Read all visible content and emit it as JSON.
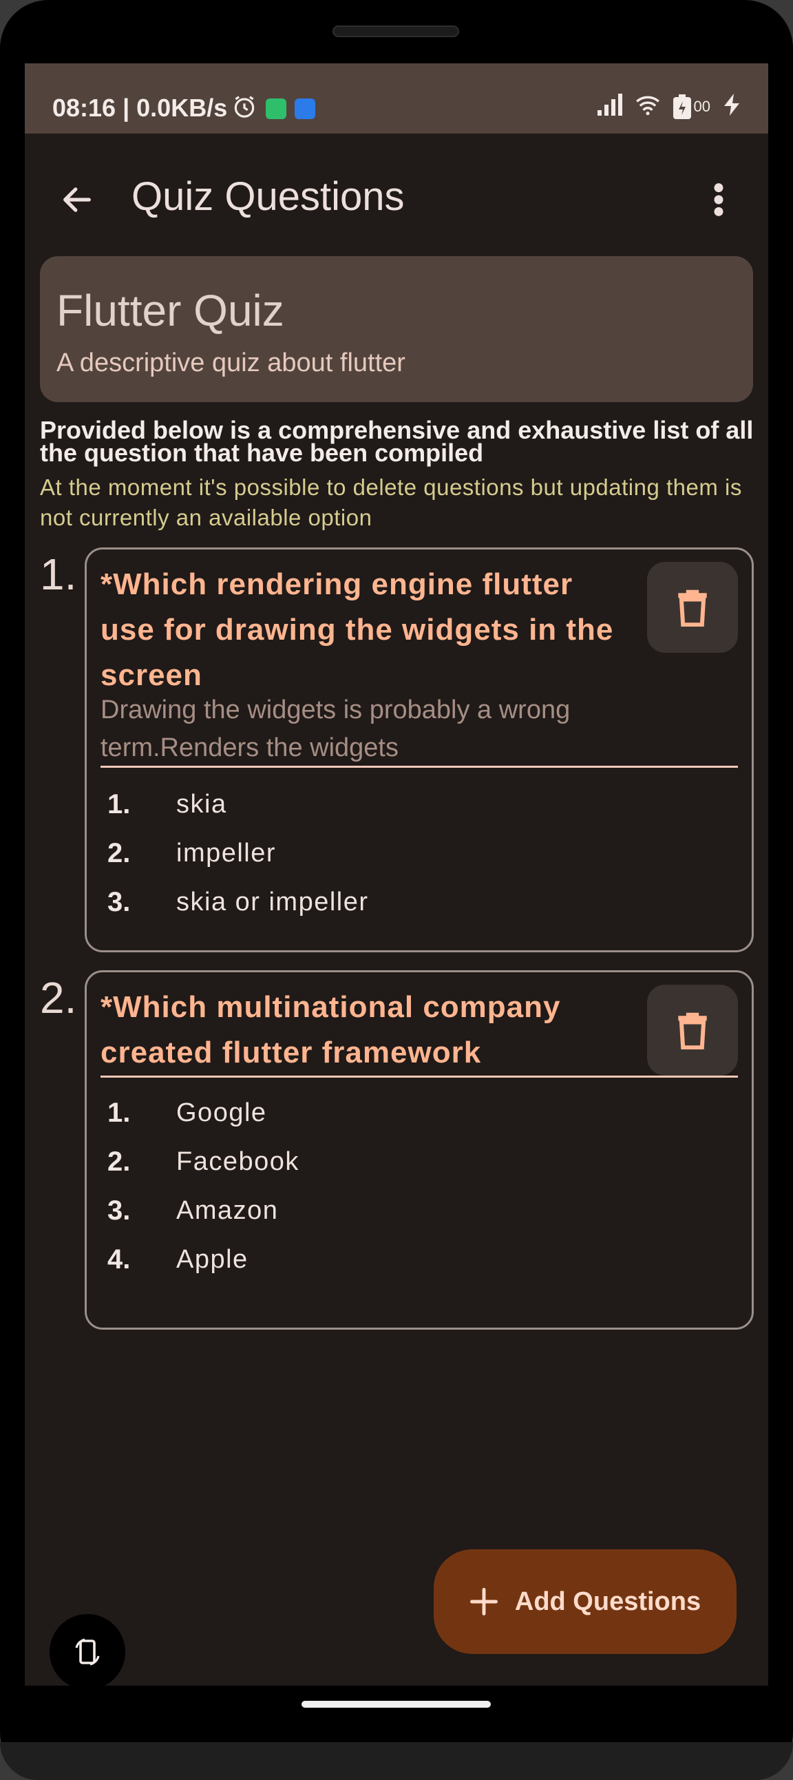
{
  "status_bar": {
    "time": "08:16 | 0.0KB/s",
    "battery": "00",
    "icons": [
      "alarm-icon",
      "app-notification-green-icon",
      "app-notification-blue-icon",
      "signal-icon",
      "wifi-icon",
      "battery-charging-icon",
      "charging-bolt-icon"
    ]
  },
  "app_bar": {
    "title": "Quiz Questions",
    "back_icon": "arrow-back-icon",
    "menu_icon": "more-vert-icon"
  },
  "quiz": {
    "title": "Flutter Quiz",
    "description": "A descriptive quiz about flutter"
  },
  "intro": "Provided below is a comprehensive and exhaustive list of all the question that have been compiled",
  "notice": "At the moment it's possible to delete questions but updating them is not currently an available option",
  "questions": [
    {
      "number": "1.",
      "text": "*Which rendering engine flutter use for drawing the widgets in the screen",
      "note": "Drawing the widgets is probably a wrong term.Renders the widgets",
      "options": [
        {
          "num": "1.",
          "label": "skia"
        },
        {
          "num": "2.",
          "label": "impeller"
        },
        {
          "num": "3.",
          "label": "skia or impeller"
        }
      ]
    },
    {
      "number": "2.",
      "text": "*Which multinational company created flutter framework",
      "note": "",
      "options": [
        {
          "num": "1.",
          "label": "Google"
        },
        {
          "num": "2.",
          "label": "Facebook"
        },
        {
          "num": "3.",
          "label": "Amazon"
        },
        {
          "num": "4.",
          "label": "Apple"
        }
      ]
    }
  ],
  "fab": {
    "label": "Add Questions",
    "icon": "plus-icon"
  },
  "colors": {
    "background": "#201a18",
    "status_bar": "#52433c",
    "card": "#52443d",
    "accent_text": "#ffb590",
    "notice": "#d5cc8f",
    "fab": "#733511"
  }
}
